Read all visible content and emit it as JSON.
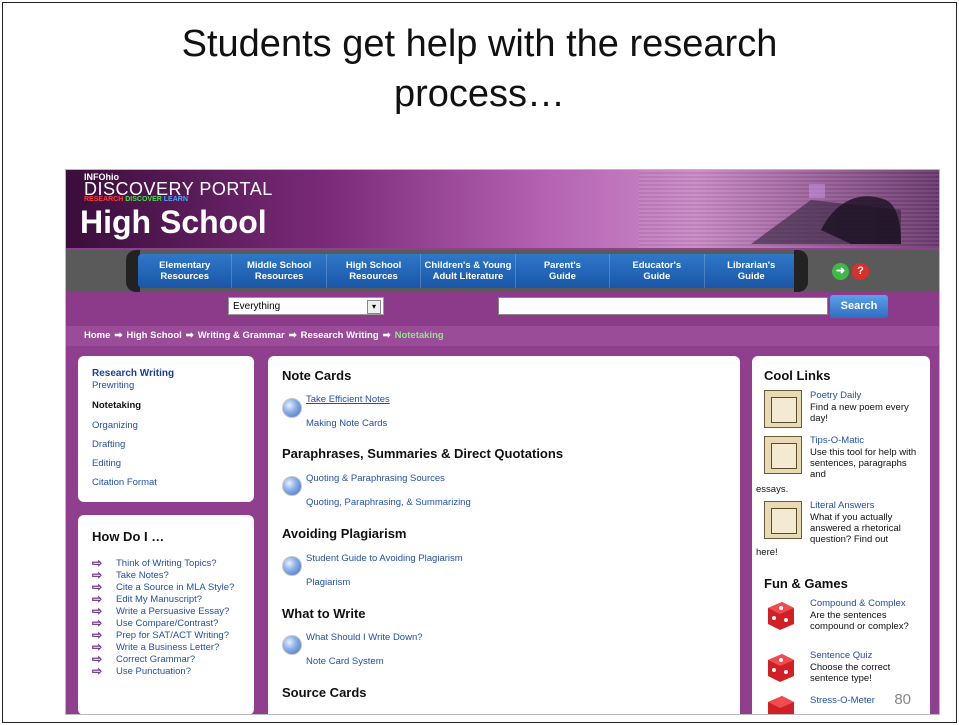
{
  "slide": {
    "title_line1": "Students get help with the research",
    "title_line2": "process…",
    "page_number": "80"
  },
  "header": {
    "small": "INFOhio",
    "portal": "DISCOVERY PORTAL",
    "tag_research": "RESEARCH",
    "tag_discover": "DISCOVER",
    "tag_learn": "LEARN",
    "school": "High School"
  },
  "nav": {
    "items": [
      {
        "line1": "Elementary",
        "line2": "Resources"
      },
      {
        "line1": "Middle School",
        "line2": "Resources"
      },
      {
        "line1": "High School",
        "line2": "Resources"
      },
      {
        "line1": "Children's & Young",
        "line2": "Adult Literature"
      },
      {
        "line1": "Parent's",
        "line2": "Guide"
      },
      {
        "line1": "Educator's",
        "line2": "Guide"
      },
      {
        "line1": "Librarian's",
        "line2": "Guide"
      }
    ],
    "help_glyph": "?"
  },
  "search": {
    "scope": "Everything",
    "button": "Search",
    "value": ""
  },
  "breadcrumb": {
    "items": [
      "Home",
      "High School",
      "Writing & Grammar",
      "Research Writing"
    ],
    "current": "Notetaking"
  },
  "left_panel": {
    "heading": "Research Writing",
    "items": [
      "Prewriting",
      "Notetaking",
      "Organizing",
      "Drafting",
      "Editing",
      "Citation Format"
    ],
    "active": "Notetaking"
  },
  "how_do_i": {
    "heading": "How Do I …",
    "items": [
      "Think of Writing Topics?",
      "Take Notes?",
      "Cite a Source in MLA Style?",
      "Edit My Manuscript?",
      "Write a Persuasive Essay?",
      "Use Compare/Contrast?",
      "Prep for SAT/ACT Writing?",
      "Write a Business Letter?",
      "Correct Grammar?",
      "Use Punctuation?"
    ]
  },
  "center": {
    "sections": [
      {
        "heading": "Note Cards",
        "links": [
          "Take Efficient Notes",
          "Making Note Cards"
        ]
      },
      {
        "heading": "Paraphrases, Summaries & Direct Quotations",
        "links": [
          "Quoting & Paraphrasing Sources",
          "Quoting, Paraphrasing, & Summarizing"
        ]
      },
      {
        "heading": "Avoiding Plagiarism",
        "links": [
          "Student Guide to Avoiding Plagiarism",
          "Plagiarism"
        ]
      },
      {
        "heading": "What to Write",
        "links": [
          "What Should I Write Down?",
          "Note Card System"
        ]
      },
      {
        "heading": "Source Cards",
        "links": []
      }
    ]
  },
  "right": {
    "cool_links_heading": "Cool Links",
    "cool_links": [
      {
        "title": "Poetry Daily",
        "desc": "Find a new poem every day!",
        "tail": ""
      },
      {
        "title": "Tips-O-Matic",
        "desc": "Use this tool for help with sentences, paragraphs and",
        "tail": "essays."
      },
      {
        "title": "Literal Answers",
        "desc": "What if you actually answered a rhetorical question? Find out",
        "tail": "here!"
      }
    ],
    "fun_heading": "Fun & Games",
    "fun": [
      {
        "title": "Compound & Complex",
        "desc": "Are the sentences compound or complex?"
      },
      {
        "title": "Sentence Quiz",
        "desc": "Choose the correct sentence type!"
      },
      {
        "title": "Stress-O-Meter",
        "desc": ""
      }
    ]
  }
}
